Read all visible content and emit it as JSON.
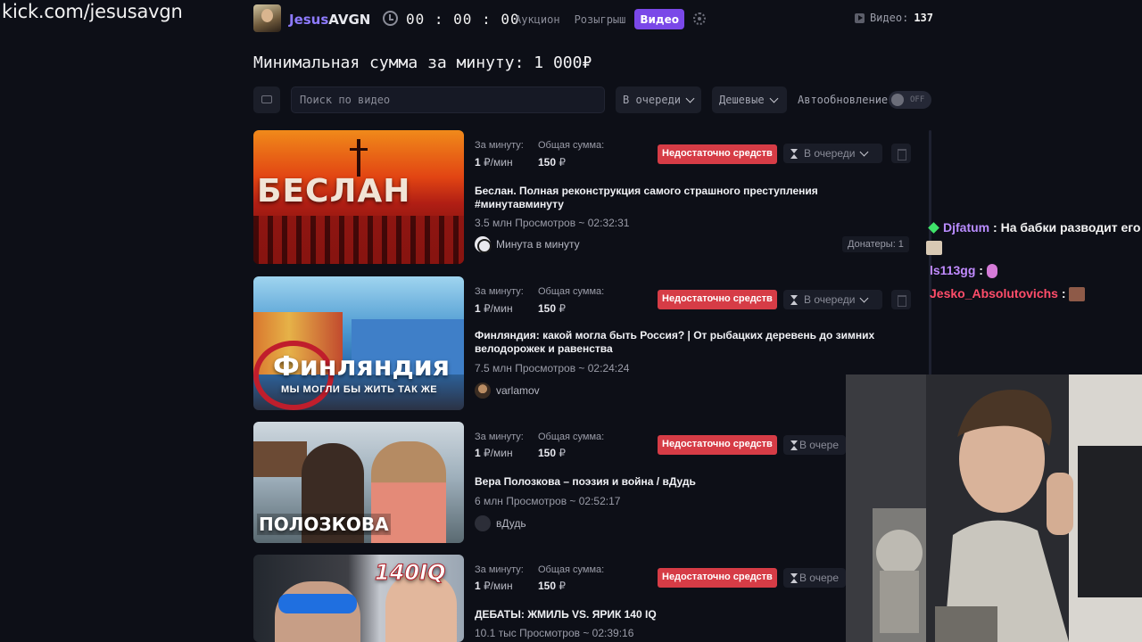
{
  "watermark": "kick.com/jesusavgn",
  "header": {
    "brand_part1": "Jesus",
    "brand_part2": "AVGN",
    "timer": "00 : 00 : 00",
    "tabs": [
      {
        "label": "Аукцион",
        "active": false
      },
      {
        "label": "Розыгрыш",
        "active": false
      },
      {
        "label": "Видео",
        "active": true
      }
    ],
    "video_count_label": "Видео:",
    "video_count": "137",
    "accent_color": "#7a48e8"
  },
  "page_title": "Минимальная сумма за минуту: 1 000₽",
  "toolbar": {
    "search_placeholder": "Поиск по видео",
    "status_filter": "В очереди",
    "sort_filter": "Дешевые",
    "auto_refresh_label": "Автообновление",
    "toggle_state": "OFF"
  },
  "videos": [
    {
      "per_minute_label": "За минуту:",
      "per_minute_value": "1",
      "per_minute_unit": "₽/мин",
      "total_label": "Общая сумма:",
      "total_value": "150",
      "total_unit": "₽",
      "badge": "Недостаточно средств",
      "status": "В очереди",
      "title": "Беслан. Полная реконструкция самого страшного преступления #минутавминуту",
      "meta": "3.5 млн Просмотров ~ 02:32:31",
      "channel": "Минута в минуту",
      "donors": "Донатеры: 1",
      "thumb_text": "БЕСЛАН"
    },
    {
      "per_minute_label": "За минуту:",
      "per_minute_value": "1",
      "per_minute_unit": "₽/мин",
      "total_label": "Общая сумма:",
      "total_value": "150",
      "total_unit": "₽",
      "badge": "Недостаточно средств",
      "status": "В очереди",
      "title": "Финляндия: какой могла быть Россия? | От рыбацких деревень до зимних велодорожек и равенства",
      "meta": "7.5 млн Просмотров ~ 02:24:24",
      "channel": "varlamov",
      "thumb_text": "Финляндия",
      "thumb_sub": "МЫ МОГЛИ БЫ ЖИТЬ ТАК ЖЕ"
    },
    {
      "per_minute_label": "За минуту:",
      "per_minute_value": "1",
      "per_minute_unit": "₽/мин",
      "total_label": "Общая сумма:",
      "total_value": "150",
      "total_unit": "₽",
      "badge": "Недостаточно средств",
      "status": "В очере",
      "title": "Вера Полозкова – поэзия и война / вДудь",
      "meta": "6 млн Просмотров ~ 02:52:17",
      "channel": "вДудь",
      "thumb_text": "ПОЛОЗКОВА"
    },
    {
      "per_minute_label": "За минуту:",
      "per_minute_value": "1",
      "per_minute_unit": "₽/мин",
      "total_label": "Общая сумма:",
      "total_value": "150",
      "total_unit": "₽",
      "badge": "Недостаточно средств",
      "status": "В очере",
      "title": "ДЕБАТЫ: ЖМИЛЬ VS. ЯРИК 140 IQ",
      "meta": "10.1 тыс Просмотров ~ 02:39:16",
      "thumb_text": "140IQ"
    }
  ],
  "chat": {
    "messages": [
      {
        "user": "Djfatum",
        "text": "На бабки разводит его"
      },
      {
        "user": "ls113gg",
        "text": ""
      },
      {
        "user": "Jesko_Absolutovichs",
        "text": ""
      }
    ],
    "separator": ":"
  }
}
